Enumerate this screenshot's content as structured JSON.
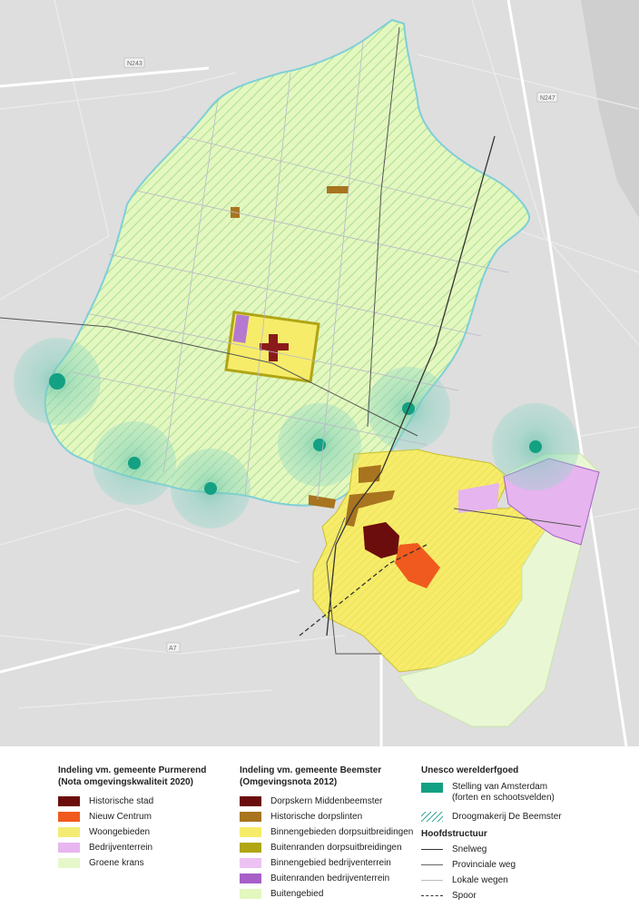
{
  "map": {
    "road_labels": [
      "N243",
      "N247",
      "A7"
    ]
  },
  "legend": {
    "purmerend": {
      "title_line1": "Indeling vm. gemeente Purmerend",
      "title_line2": "(Nota omgevingskwaliteit 2020)",
      "items": [
        {
          "label": "Historische stad",
          "color": "#6b0d0d"
        },
        {
          "label": "Nieuw Centrum",
          "color": "#f05a1e"
        },
        {
          "label": "Woongebieden",
          "color": "#f3ec74"
        },
        {
          "label": "Bedrijventerrein",
          "color": "#e7b6ee"
        },
        {
          "label": "Groene krans",
          "color": "#e6f7cc"
        }
      ]
    },
    "beemster": {
      "title_line1": "Indeling vm. gemeente Beemster",
      "title_line2": "(Omgevingsnota 2012)",
      "items": [
        {
          "label": "Dorpskern Middenbeemster",
          "color": "#6b0d0d"
        },
        {
          "label": "Historische dorpslinten",
          "color": "#a8741f"
        },
        {
          "label": "Binnengebieden dorpsuitbreidingen",
          "color": "#f6ec6a"
        },
        {
          "label": "Buitenranden dorpsuitbreidingen",
          "color": "#b0a514"
        },
        {
          "label": "Binnengebied bedrijventerrein",
          "color": "#ecc2f2"
        },
        {
          "label": "Buitenranden bedrijventerrein",
          "color": "#a760c8"
        },
        {
          "label": "Buitengebied",
          "color": "#e3f7bf"
        }
      ]
    },
    "unesco": {
      "title": "Unesco werelderfgoed",
      "stelling_line1": "Stelling van Amsterdam",
      "stelling_line2": "(forten en schootsvelden)",
      "stelling_color": "#14a082",
      "droogmakerij": "Droogmakerij De Beemster",
      "hatch_color": "#3aa89a"
    },
    "hoofdstructuur": {
      "title": "Hoofdstructuur",
      "items": [
        {
          "label": "Snelweg",
          "style": "solid-thick"
        },
        {
          "label": "Provinciale weg",
          "style": "solid"
        },
        {
          "label": "Lokale wegen",
          "style": "solid-light"
        },
        {
          "label": "Spoor",
          "style": "dashed"
        }
      ]
    }
  }
}
